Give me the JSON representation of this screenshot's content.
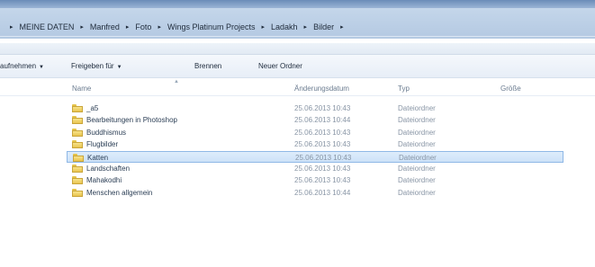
{
  "breadcrumb": {
    "items": [
      "MEINE DATEN",
      "Manfred",
      "Foto",
      "Wings Platinum Projects",
      "Ladakh",
      "Bilder"
    ],
    "separator": "▸"
  },
  "toolbar": {
    "include_label": "aufnehmen",
    "share_label": "Freigeben für",
    "burn_label": "Brennen",
    "new_folder_label": "Neuer Ordner"
  },
  "columns": {
    "name": "Name",
    "date": "Änderungsdatum",
    "type": "Typ",
    "size": "Größe"
  },
  "files": [
    {
      "name": "_a5",
      "date": "25.06.2013 10:43",
      "type": "Dateiordner",
      "selected": false
    },
    {
      "name": "Bearbeitungen in Photoshop",
      "date": "25.06.2013 10:44",
      "type": "Dateiordner",
      "selected": false
    },
    {
      "name": "Buddhismus",
      "date": "25.06.2013 10:43",
      "type": "Dateiordner",
      "selected": false
    },
    {
      "name": "Flugbilder",
      "date": "25.06.2013 10:43",
      "type": "Dateiordner",
      "selected": false
    },
    {
      "name": "Katten",
      "date": "25.06.2013 10:43",
      "type": "Dateiordner",
      "selected": true
    },
    {
      "name": "Landschaften",
      "date": "25.06.2013 10:43",
      "type": "Dateiordner",
      "selected": false
    },
    {
      "name": "Mahakodhi",
      "date": "25.06.2013 10:43",
      "type": "Dateiordner",
      "selected": false
    },
    {
      "name": "Menschen allgemein",
      "date": "25.06.2013 10:44",
      "type": "Dateiordner",
      "selected": false
    }
  ],
  "colors": {
    "selection_bg": "#cde2f8",
    "selection_border": "#8fb8e6",
    "folder": "#e8c44f"
  }
}
